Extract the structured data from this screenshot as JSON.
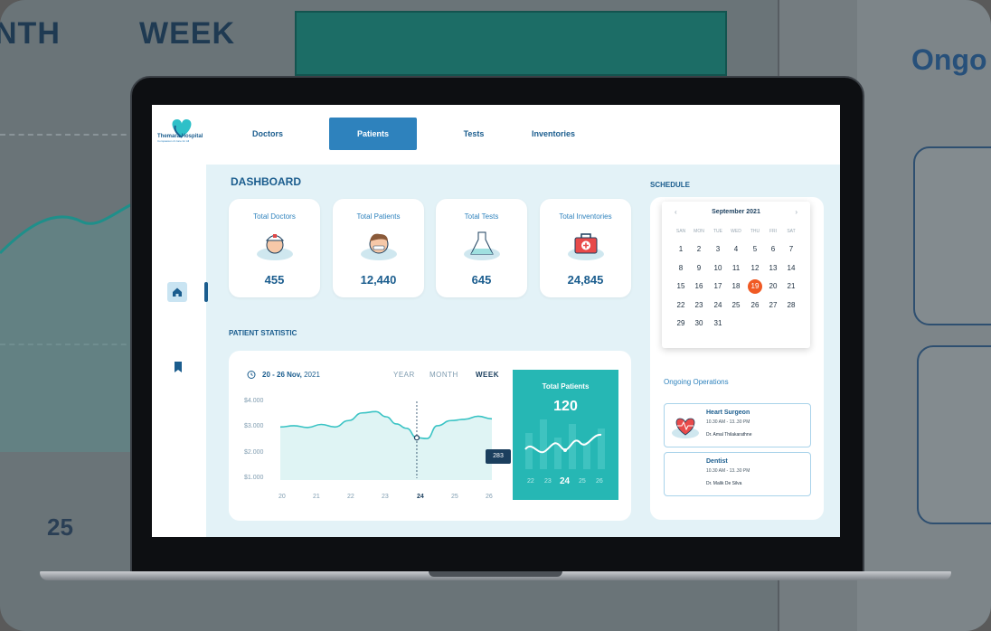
{
  "background": {
    "tab_month": "NTH",
    "tab_week": "WEEK",
    "ongoing": "Ongo",
    "day_25": "25"
  },
  "app": {
    "name": "Themara Hospital",
    "tagline": "Compassion & Care for All"
  },
  "nav": [
    {
      "label": "Doctors",
      "active": false
    },
    {
      "label": "Patients",
      "active": true
    },
    {
      "label": "Tests",
      "active": false
    },
    {
      "label": "Inventories",
      "active": false
    }
  ],
  "rail": {
    "home_icon": "home-icon",
    "bookmark_icon": "bookmark-icon"
  },
  "dashboard": {
    "title": "DASHBOARD",
    "stats": [
      {
        "label": "Total Doctors",
        "value": "455",
        "icon": "doctor-icon"
      },
      {
        "label": "Total Patients",
        "value": "12,440",
        "icon": "patient-icon"
      },
      {
        "label": "Total Tests",
        "value": "645",
        "icon": "test-flask-icon"
      },
      {
        "label": "Total Inventories",
        "value": "24,845",
        "icon": "first-aid-kit-icon"
      }
    ]
  },
  "patient_statistic": {
    "title": "PATIENT STATISTIC",
    "date_range_bold": "20 - 26 Nov,",
    "date_range_year": "2021",
    "timeframes": [
      "YEAR",
      "MONTH",
      "WEEK"
    ],
    "active_timeframe": "WEEK",
    "tooltip_value": "283",
    "total_patients_label": "Total Patients",
    "total_patients_value": "120",
    "mini_x": [
      "22",
      "23",
      "24",
      "25",
      "26"
    ],
    "mini_active": "24"
  },
  "chart_data": {
    "type": "area",
    "title": "",
    "xlabel": "",
    "ylabel": "",
    "x": [
      "20",
      "21",
      "22",
      "23",
      "24",
      "25",
      "26"
    ],
    "y_ticks": [
      "$4.000",
      "$3.000",
      "$2.000",
      "$1.000"
    ],
    "ylim": [
      1000,
      4000
    ],
    "series": [
      {
        "name": "",
        "points": [
          [
            20,
            3000
          ],
          [
            20.4,
            3050
          ],
          [
            20.8,
            2980
          ],
          [
            21.2,
            3100
          ],
          [
            21.6,
            3000
          ],
          [
            22.0,
            3250
          ],
          [
            22.4,
            3550
          ],
          [
            22.8,
            3600
          ],
          [
            23.1,
            3400
          ],
          [
            23.4,
            3120
          ],
          [
            23.7,
            2950
          ],
          [
            24.0,
            2580
          ],
          [
            24.3,
            2550
          ],
          [
            24.6,
            3050
          ],
          [
            25.0,
            3250
          ],
          [
            25.4,
            3300
          ],
          [
            25.8,
            3420
          ],
          [
            26.2,
            3320
          ]
        ]
      }
    ],
    "highlight": {
      "x": "24",
      "label": "283"
    }
  },
  "schedule": {
    "title": "SCHEDULE",
    "month": "September 2021",
    "weekdays": [
      "SAN",
      "MON",
      "TUE",
      "WED",
      "THU",
      "FRI",
      "SAT"
    ],
    "weeks": [
      [
        "1",
        "2",
        "3",
        "4",
        "5",
        "6",
        "7"
      ],
      [
        "8",
        "9",
        "10",
        "11",
        "12",
        "13",
        "14"
      ],
      [
        "15",
        "16",
        "17",
        "18",
        "19",
        "20",
        "21"
      ],
      [
        "22",
        "23",
        "24",
        "25",
        "26",
        "27",
        "28"
      ],
      [
        "29",
        "30",
        "31",
        "",
        "",
        "",
        ""
      ]
    ],
    "selected": "19"
  },
  "ongoing": {
    "title": "Ongoing Operations",
    "items": [
      {
        "name": "Heart Surgeon",
        "time": "10.30 AM - 13..30 PM",
        "doctor": "Dr. Amal Thilakarathne",
        "icon": "heart-icon"
      },
      {
        "name": "Dentist",
        "time": "10.30 AM - 13..30 PM",
        "doctor": "Dr. Malik De Silva",
        "icon": ""
      }
    ]
  },
  "colors": {
    "primary": "#1b5d8e",
    "accent": "#2e82bd",
    "teal": "#26b7b4",
    "selected_day": "#f05a24"
  }
}
